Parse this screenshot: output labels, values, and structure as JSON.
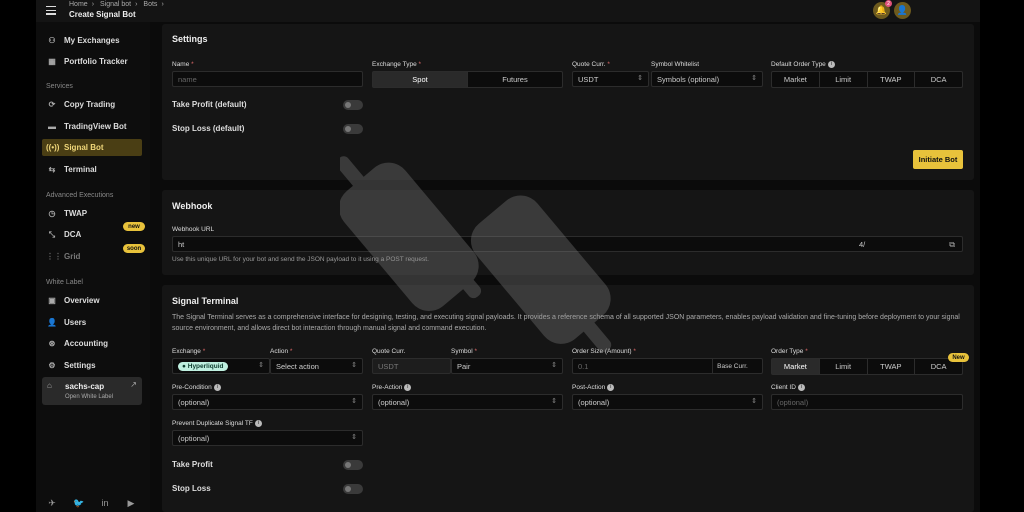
{
  "header": {
    "breadcrumb": [
      "Home",
      "Signal bot",
      "Bots"
    ],
    "title": "Create Signal Bot",
    "notif_count": "2"
  },
  "sidebar": {
    "top": [
      {
        "label": "My Exchanges",
        "icon": "exchange-icon"
      },
      {
        "label": "Portfolio Tracker",
        "icon": "portfolio-icon"
      }
    ],
    "services_title": "Services",
    "services": [
      {
        "label": "Copy Trading",
        "icon": "copy-icon"
      },
      {
        "label": "TradingView Bot",
        "icon": "tradingview-icon"
      },
      {
        "label": "Signal Bot",
        "icon": "signal-icon"
      },
      {
        "label": "Terminal",
        "icon": "terminal-icon"
      }
    ],
    "advanced_title": "Advanced Executions",
    "advanced": [
      {
        "label": "TWAP"
      },
      {
        "label": "DCA",
        "badge": "new"
      },
      {
        "label": "Grid",
        "badge": "soon"
      }
    ],
    "whitelabel_title": "White Label",
    "whitelabel": [
      {
        "label": "Overview"
      },
      {
        "label": "Users"
      },
      {
        "label": "Accounting"
      },
      {
        "label": "Settings"
      }
    ],
    "wl_card": {
      "name": "sachs-cap",
      "sub": "Open White Label"
    }
  },
  "settings": {
    "title": "Settings",
    "name_label": "Name",
    "name_placeholder": "name",
    "exchange_type_label": "Exchange Type",
    "exchange_types": [
      "Spot",
      "Futures"
    ],
    "quote_label": "Quote Curr.",
    "quote_value": "USDT",
    "whitelist_label": "Symbol Whitelist",
    "whitelist_placeholder": "Symbols (optional)",
    "order_type_label": "Default Order Type",
    "order_types": [
      "Market",
      "Limit",
      "TWAP",
      "DCA"
    ],
    "take_profit": "Take Profit (default)",
    "stop_loss": "Stop Loss (default)",
    "initiate": "Initiate Bot"
  },
  "webhook": {
    "title": "Webhook",
    "url_label": "Webhook URL",
    "url_start": "ht",
    "url_end": "4/",
    "hint": "Use this unique URL for your bot and send the JSON payload to it using a POST request."
  },
  "terminal": {
    "title": "Signal Terminal",
    "desc": "The Signal Terminal serves as a comprehensive interface for designing, testing, and executing signal payloads. It provides a reference schema of all supported JSON parameters, enables payload validation and fine-tuning before deployment to your signal source environment, and allows direct bot interaction through manual signal and command execution.",
    "exchange_label": "Exchange",
    "exchange_value": "Hyperliquid",
    "action_label": "Action",
    "action_placeholder": "Select action",
    "quote_label": "Quote Curr.",
    "quote_value": "USDT",
    "symbol_label": "Symbol",
    "symbol_placeholder": "Pair",
    "size_label": "Order Size (Amount)",
    "size_placeholder": "0.1",
    "base_curr": "Base Curr.",
    "order_type_label": "Order Type",
    "order_types": [
      "Market",
      "Limit",
      "TWAP",
      "DCA"
    ],
    "new_badge": "New",
    "precondition_label": "Pre-Condition",
    "preaction_label": "Pre-Action",
    "postaction_label": "Post-Action",
    "clientid_label": "Client ID",
    "optional": "(optional)",
    "dup_label": "Prevent Duplicate Signal TF",
    "take_profit": "Take Profit",
    "stop_loss": "Stop Loss"
  }
}
